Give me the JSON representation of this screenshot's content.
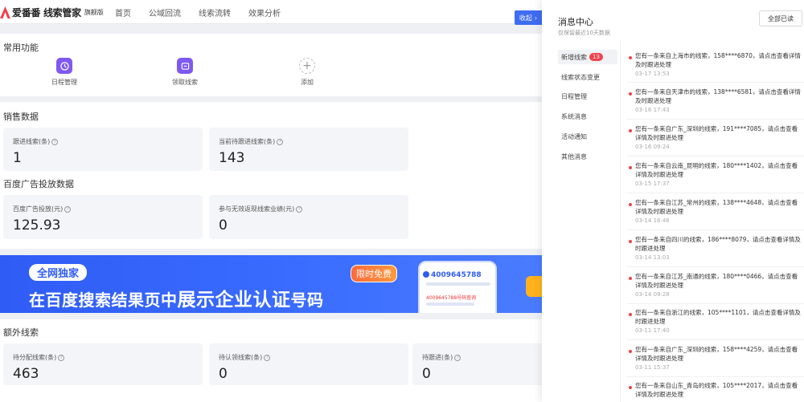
{
  "app": {
    "logo_text": "爱番番 线索管家",
    "logo_sub": "旗舰版",
    "brand_color": "#f2414a",
    "accent_color": "#3e6cf2"
  },
  "nav": {
    "items": [
      "首页",
      "公域回流",
      "线索流转",
      "效果分析"
    ]
  },
  "quick": {
    "title": "常用功能",
    "items": [
      {
        "label": "日程管理",
        "icon": "clock-icon"
      },
      {
        "label": "领取线索",
        "icon": "inbox-icon"
      },
      {
        "label": "添加",
        "icon": "plus-icon"
      }
    ]
  },
  "sales": {
    "title": "销售数据",
    "stats": [
      {
        "label": "跟进线索(条)",
        "value": "1"
      },
      {
        "label": "当前待跟进线索(条)",
        "value": "143"
      }
    ]
  },
  "ads": {
    "title": "百度广告投放数据",
    "stats": [
      {
        "label": "百度广告投放(元)",
        "value": "125.93"
      },
      {
        "label": "参与无效返现线索业绩(元)",
        "value": "0"
      }
    ]
  },
  "banner": {
    "tag": "全网独家",
    "line_start": "在百度搜索结果页中",
    "line_highlight": "展示企业认证",
    "line_end": "号码",
    "badge": "限时免费",
    "phone_number": "4009645788",
    "phone_red": "4009645788号码查询",
    "bg_color": "#2f5cf5"
  },
  "extra": {
    "title": "额外线索",
    "stats": [
      {
        "label": "待分配线索(条)",
        "value": "463"
      },
      {
        "label": "待认领线索(条)",
        "value": "0"
      },
      {
        "label": "待跟进(条)",
        "value": "0"
      }
    ]
  },
  "collapse_button": {
    "label": "收起",
    "icon": "chevron-right-icon"
  },
  "drawer": {
    "title": "消息中心",
    "subtitle": "仅保留最近10天数据",
    "read_all": "全部已读",
    "categories": [
      {
        "label": "新增线索",
        "badge": "13"
      },
      {
        "label": "线索状态变更",
        "badge": ""
      },
      {
        "label": "日程管理",
        "badge": ""
      },
      {
        "label": "系统消息",
        "badge": ""
      },
      {
        "label": "活动通知",
        "badge": ""
      },
      {
        "label": "其他消息",
        "badge": ""
      }
    ],
    "messages": [
      {
        "text": "您有一条来自上海市的线索，158****6870，请点击查看详情及时跟进处理",
        "time": "03-17 13:53"
      },
      {
        "text": "您有一条来自天津市的线索，138****6581，请点击查看详情及时跟进处理",
        "time": "03-16 17:43"
      },
      {
        "text": "您有一条来自广东_深圳的线索，191****7085，请点击查看详情及时跟进处理",
        "time": "03-16 09:24"
      },
      {
        "text": "您有一条来自云南_昆明的线索，180****1402，请点击查看详情及时跟进处理",
        "time": "03-15 17:37"
      },
      {
        "text": "您有一条来自江苏_常州的线索，138****4648，请点击查看详情及时跟进处理",
        "time": "03-14 16:46"
      },
      {
        "text": "您有一条来自四川的线索，186****8079，请点击查看详情及时跟进处理",
        "time": "03-14 13:03"
      },
      {
        "text": "您有一条来自江苏_南通的线索，180****0466，请点击查看详情及时跟进处理",
        "time": "03-14 09:28"
      },
      {
        "text": "您有一条来自浙江的线索，105****1101，请点击查看详情及时跟进处理",
        "time": "03-11 17:40"
      },
      {
        "text": "您有一条来自广东_深圳的线索，158****4259，请点击查看详情及时跟进处理",
        "time": "03-11 15:37"
      },
      {
        "text": "您有一条来自山东_青岛的线索，105****2017，请点击查看详情及时跟进处理",
        "time": ""
      }
    ]
  }
}
